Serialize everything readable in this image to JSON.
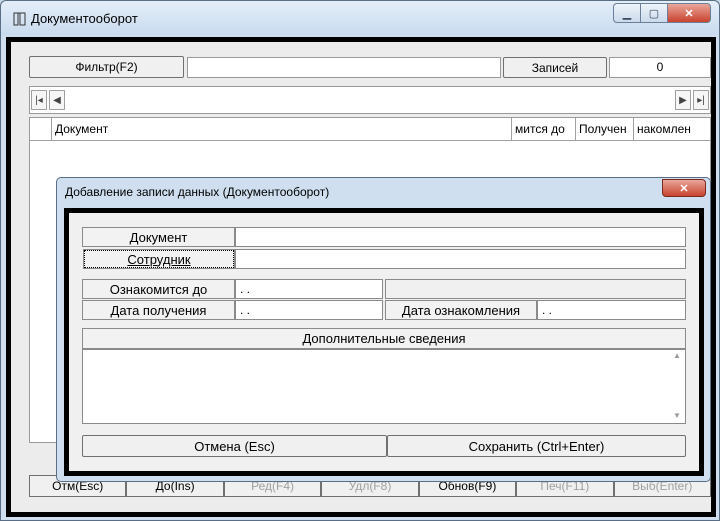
{
  "window": {
    "title": "Документооборот"
  },
  "filter": {
    "button_label": "Фильтр(F2)",
    "value": "",
    "records_label": "Записей",
    "records_count": "0"
  },
  "nav": {
    "first": "◂|",
    "prev": "◀",
    "next": "▶",
    "last": "▸|"
  },
  "grid": {
    "columns": [
      "Документ",
      "мится до",
      "Получен",
      "накомлен"
    ]
  },
  "toolbar": {
    "buttons": [
      "Отм(Esc)",
      "До(Ins)",
      "Ред(F4)",
      "Удл(F8)",
      "Обнов(F9)",
      "Печ(F11)",
      "Выб(Enter)"
    ]
  },
  "dialog": {
    "title": "Добавление записи данных  (Документооборот)",
    "document_label": "Документ",
    "document_value": "",
    "employee_label": "Сотрудник",
    "employee_value": "",
    "acquaint_until_label": "Ознакомится до",
    "acquaint_until_value": ". .",
    "received_date_label": "Дата получения",
    "received_date_value": ". .",
    "acquaint_date_label": "Дата ознакомления",
    "acquaint_date_value": ". .",
    "extra_label": "Дополнительные сведения",
    "extra_value": "",
    "cancel_label": "Отмена (Esc)",
    "save_label": "Сохранить (Ctrl+Enter)"
  }
}
